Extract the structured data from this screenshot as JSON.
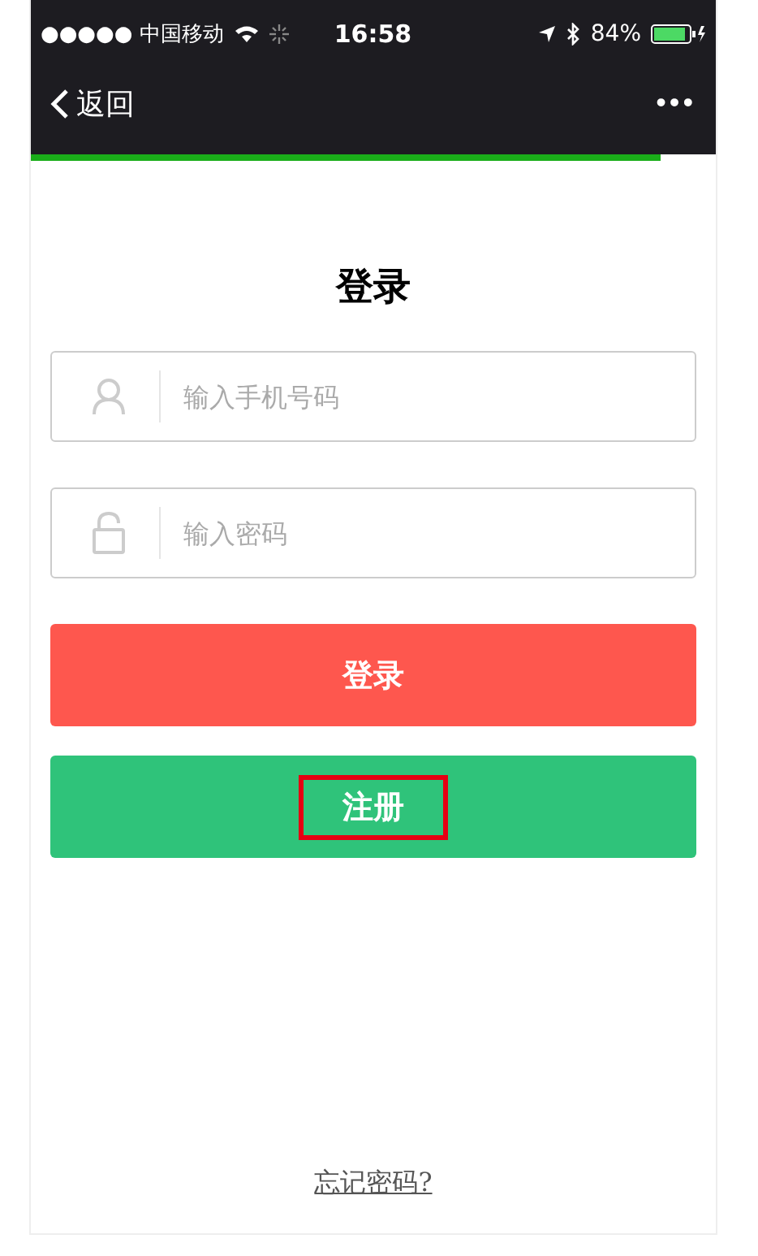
{
  "status_bar": {
    "carrier": "●●●●● 中国移动",
    "time": "16:58",
    "battery": "84%"
  },
  "nav": {
    "back": "返回",
    "more": "•••",
    "progress": {
      "level": 0.92
    }
  },
  "title": "登录",
  "fields": [
    {
      "kind": "user",
      "placeholder": "输入手机号码"
    },
    {
      "kind": "lock",
      "placeholder": "输入密码"
    }
  ],
  "buttons": [
    {
      "label": "登录",
      "color": "#fe574e",
      "highlighted": false
    },
    {
      "label": "注册",
      "color": "#2fc37a",
      "highlighted": true
    }
  ],
  "forgot_link": "忘记密码?"
}
